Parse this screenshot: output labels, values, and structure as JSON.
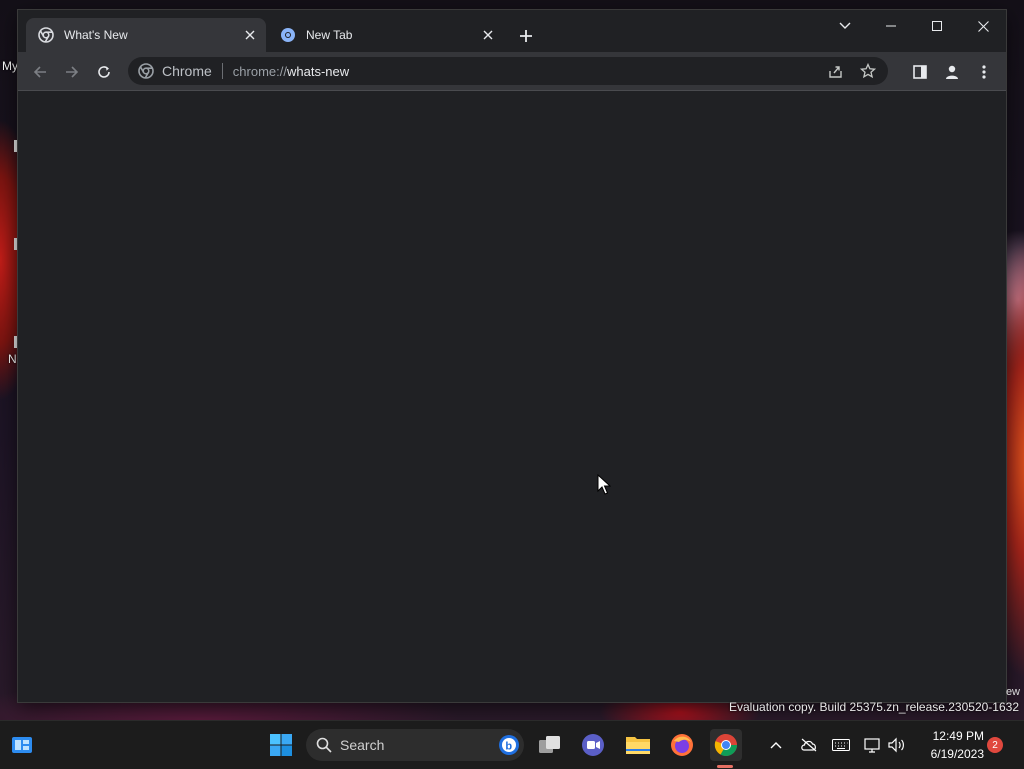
{
  "desktop": {
    "labels": [
      "My",
      "N"
    ]
  },
  "browser": {
    "tabs": [
      {
        "title": "What's New",
        "favicon": "chrome-icon",
        "active": true
      },
      {
        "title": "New Tab",
        "favicon": "chrome-icon",
        "active": false
      }
    ],
    "omnibox": {
      "site_label": "Chrome",
      "url_scheme": "chrome://",
      "url_host": "whats-new"
    },
    "colors": {
      "frame": "#202124",
      "toolbar": "#35363a",
      "text": "#e8eaed"
    }
  },
  "watermark": {
    "text": "Evaluation copy. Build 25375.zn_release.230520-1632",
    "edge_text": "ew"
  },
  "taskbar": {
    "search_placeholder": "Search",
    "clock_time": "12:49 PM",
    "clock_date": "6/19/2023",
    "notification_count": "2",
    "apps": [
      "widgets-icon",
      "start-icon",
      "task-view-icon",
      "chat-icon",
      "file-explorer-icon",
      "firefox-icon",
      "chrome-icon"
    ]
  }
}
